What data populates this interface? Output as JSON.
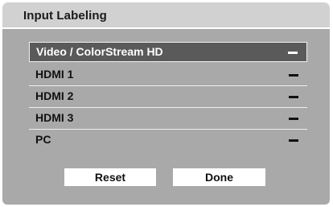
{
  "dialog": {
    "title": "Input Labeling"
  },
  "inputs": [
    {
      "label": "Video / ColorStream HD",
      "value": "–",
      "selected": true
    },
    {
      "label": "HDMI 1",
      "value": "–",
      "selected": false
    },
    {
      "label": "HDMI 2",
      "value": "–",
      "selected": false
    },
    {
      "label": "HDMI 3",
      "value": "–",
      "selected": false
    },
    {
      "label": "PC",
      "value": "–",
      "selected": false
    }
  ],
  "buttons": {
    "reset_label": "Reset",
    "done_label": "Done"
  },
  "colors": {
    "title_bar": "#d1d1d1",
    "panel": "#a9a9a9",
    "selected_row": "#5a5a5a",
    "separator": "#efefef",
    "button": "#ffffff"
  }
}
